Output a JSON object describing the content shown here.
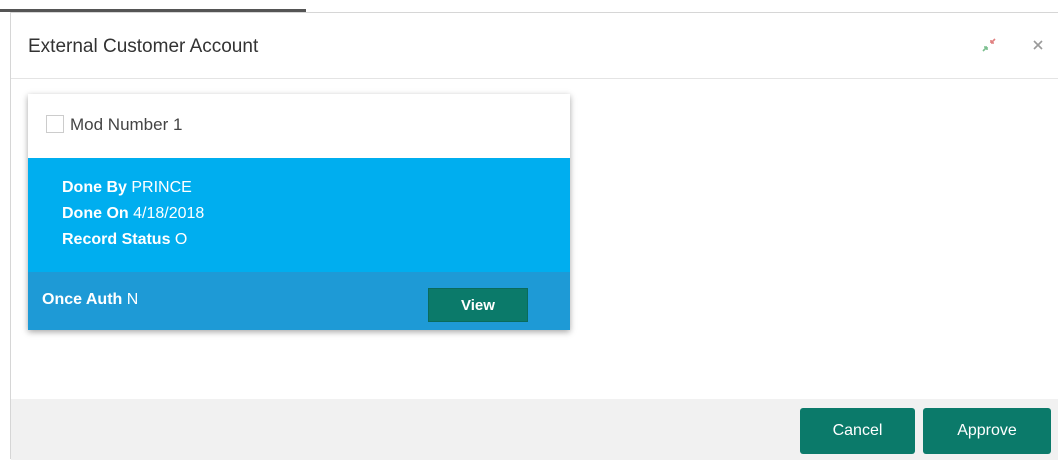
{
  "dialog": {
    "title": "External Customer Account",
    "minimize_icon": "minimize-icon",
    "close_icon": "close-icon"
  },
  "card": {
    "checkbox_checked": false,
    "mod_label": "Mod Number 1",
    "done_by_label": "Done By",
    "done_by_value": "PRINCE",
    "done_on_label": "Done On",
    "done_on_value": "4/18/2018",
    "record_status_label": "Record Status",
    "record_status_value": "O",
    "once_auth_label": "Once Auth",
    "once_auth_value": "N",
    "view_label": "View"
  },
  "footer": {
    "cancel_label": "Cancel",
    "approve_label": "Approve"
  },
  "colors": {
    "info_bg": "#00aeef",
    "footer_bar_bg": "#1e9ad6",
    "button_bg": "#0b7a6a"
  }
}
